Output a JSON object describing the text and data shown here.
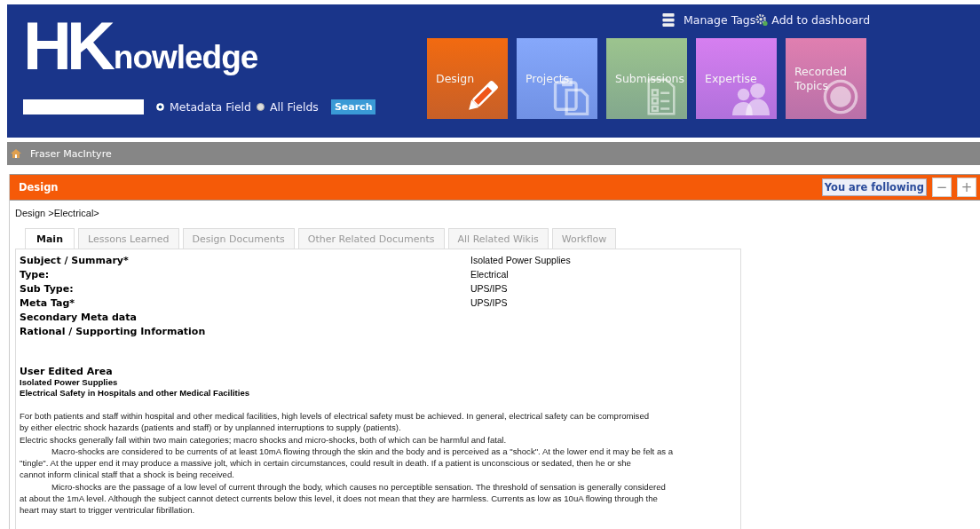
{
  "header": {
    "logo": {
      "mark": "HK",
      "word": "nowledge"
    },
    "links": [
      {
        "kind": "tags",
        "label": "Manage Tags"
      },
      {
        "kind": "dashboard",
        "label": "Add to dashboard"
      }
    ],
    "search": {
      "button": "Search",
      "options": [
        {
          "label": "Metadata Field",
          "selected": true
        },
        {
          "label": "All Fields",
          "selected": false
        }
      ]
    },
    "tiles": [
      {
        "label": "Design",
        "kind": "pencil",
        "color": "#f26a10"
      },
      {
        "label": "Projects",
        "kind": "clipboard",
        "color": "#86a8fb"
      },
      {
        "label": "Submissions",
        "kind": "checklist",
        "color": "#9cc48e"
      },
      {
        "label": "Expertise",
        "kind": "people",
        "color": "#d67ff0"
      },
      {
        "label": "Recorded Topics",
        "kind": "record",
        "color": "#e07fb0"
      }
    ]
  },
  "user_bar": {
    "name": "Fraser MacIntyre"
  },
  "panel": {
    "title": "Design",
    "follow": "You are following",
    "buttons": [
      "−",
      "+"
    ],
    "breadcrumb": "Design >Electrical>",
    "tabs": [
      {
        "label": "Main",
        "selected": true
      },
      {
        "label": "Lessons Learned",
        "selected": false
      },
      {
        "label": "Design Documents",
        "selected": false
      },
      {
        "label": "Other Related Documents",
        "selected": false
      },
      {
        "label": "All Related Wikis",
        "selected": false
      },
      {
        "label": "Workflow",
        "selected": false
      }
    ],
    "fields": [
      {
        "label": "Subject / Summary*",
        "value": "Isolated Power Supplies"
      },
      {
        "label": "Type:",
        "value": "Electrical"
      },
      {
        "label": "Sub Type:",
        "value": "UPS/IPS"
      },
      {
        "label": "Meta Tag*",
        "value": "UPS/IPS"
      },
      {
        "label": "Secondary Meta data"
      },
      {
        "label": "Rational / Supporting Information"
      }
    ],
    "user_area": {
      "heading": "User Edited Area",
      "subheadings": [
        "Isolated Power Supplies",
        "Electrical Safety in Hospitals and other Medical Facilities"
      ],
      "paragraphs": [
        {
          "indent": false,
          "lines": [
            "For both patients and staff within hospital and other medical facilities, high levels of electrical safety must be achieved.  In general, electrical safety can be compromised",
            "by either electric shock hazards (patients and staff) or by unplanned interruptions to supply (patients)."
          ]
        },
        {
          "indent": false,
          "lines": [
            "Electric shocks generally fall within two main categories; macro shocks and micro-shocks, both of which can be harmful and fatal."
          ]
        },
        {
          "indent": true,
          "lines": [
            "Macro-shocks are considered to be currents of at least 10mA flowing through the skin and the body and is perceived as a \"shock\". At the lower end it may be felt as a",
            "\"tingle\".  At the  upper end it may produce a massive jolt, which in certain circumstances,  could result in death.  If a patient is unconscious or sedated, then he or she",
            "cannot inform clinical staff that a shock is being received."
          ]
        },
        {
          "indent": true,
          "lines": [
            "Micro-shocks are the passage of a low level of current through the body, which causes no perceptible sensation.  The threshold of sensation is generally considered",
            "at about the 1mA level.  Although the subject cannot detect currents below this level, it does not mean that they are harmless.  Currents as low as 10uA flowing through the",
            "heart may start to trigger ventricular fibrillation."
          ]
        }
      ]
    }
  }
}
